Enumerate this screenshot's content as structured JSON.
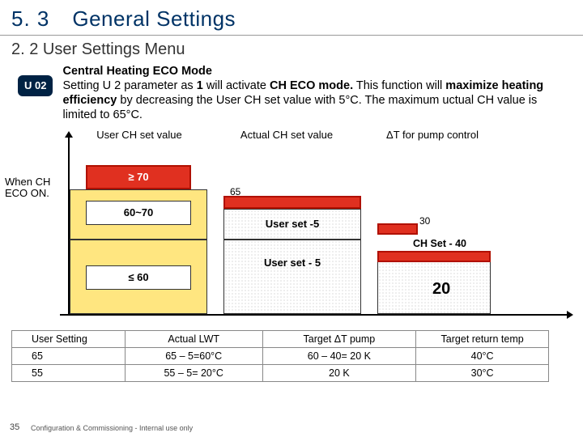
{
  "header": {
    "section": "5. 3",
    "title": "General Settings"
  },
  "subhead": "2. 2 User Settings Menu",
  "badge": "U 02",
  "desc": {
    "h1": "Central Heating ECO Mode",
    "line": "Setting U 2 parameter as",
    "one": "1",
    "mid": "will activate",
    "mode": "CH ECO mode.",
    "rest": "This function will",
    "line2a": "maximize heating efficiency",
    "line2b": "by decreasing the User CH set value with 5°C. The maximum uctual CH value is limited to 65°C."
  },
  "diagram": {
    "col1": "User CH set value",
    "col2": "Actual CH set value",
    "col3": "ΔT for pump control",
    "side": "When CH ECO ON.",
    "b1": "≥ 70",
    "b2": "60~70",
    "b3": "≤ 60",
    "u1": "User set -5",
    "u2": "User set - 5",
    "lbl65": "65",
    "lbl30": "30",
    "chset": "CH Set - 40",
    "twenty": "20"
  },
  "table": {
    "h1": "User Setting",
    "h2": "Actual LWT",
    "h3": "Target ΔT pump",
    "h4": "Target return temp",
    "rows": [
      {
        "c1": "65",
        "c2": "65 – 5=60°C",
        "c3": "60 – 40= 20 K",
        "c4": "40°C"
      },
      {
        "c1": "55",
        "c2": "55 – 5= 20°C",
        "c3": "20 K",
        "c4": "30°C"
      }
    ]
  },
  "footer": {
    "page": "35",
    "note": "Configuration & Commissioning - Internal use only"
  },
  "chart_data": {
    "type": "table",
    "title": "CH ECO mode behaviour",
    "columns": [
      "User CH set value",
      "Actual CH set value",
      "ΔT for pump control"
    ],
    "rows": [
      {
        "user_ch": "≥ 70",
        "actual_ch": "65",
        "delta_t": "30"
      },
      {
        "user_ch": "60~70",
        "actual_ch": "User set - 5",
        "delta_t": "CH Set - 40"
      },
      {
        "user_ch": "≤ 60",
        "actual_ch": "User set - 5",
        "delta_t": "20"
      }
    ]
  }
}
